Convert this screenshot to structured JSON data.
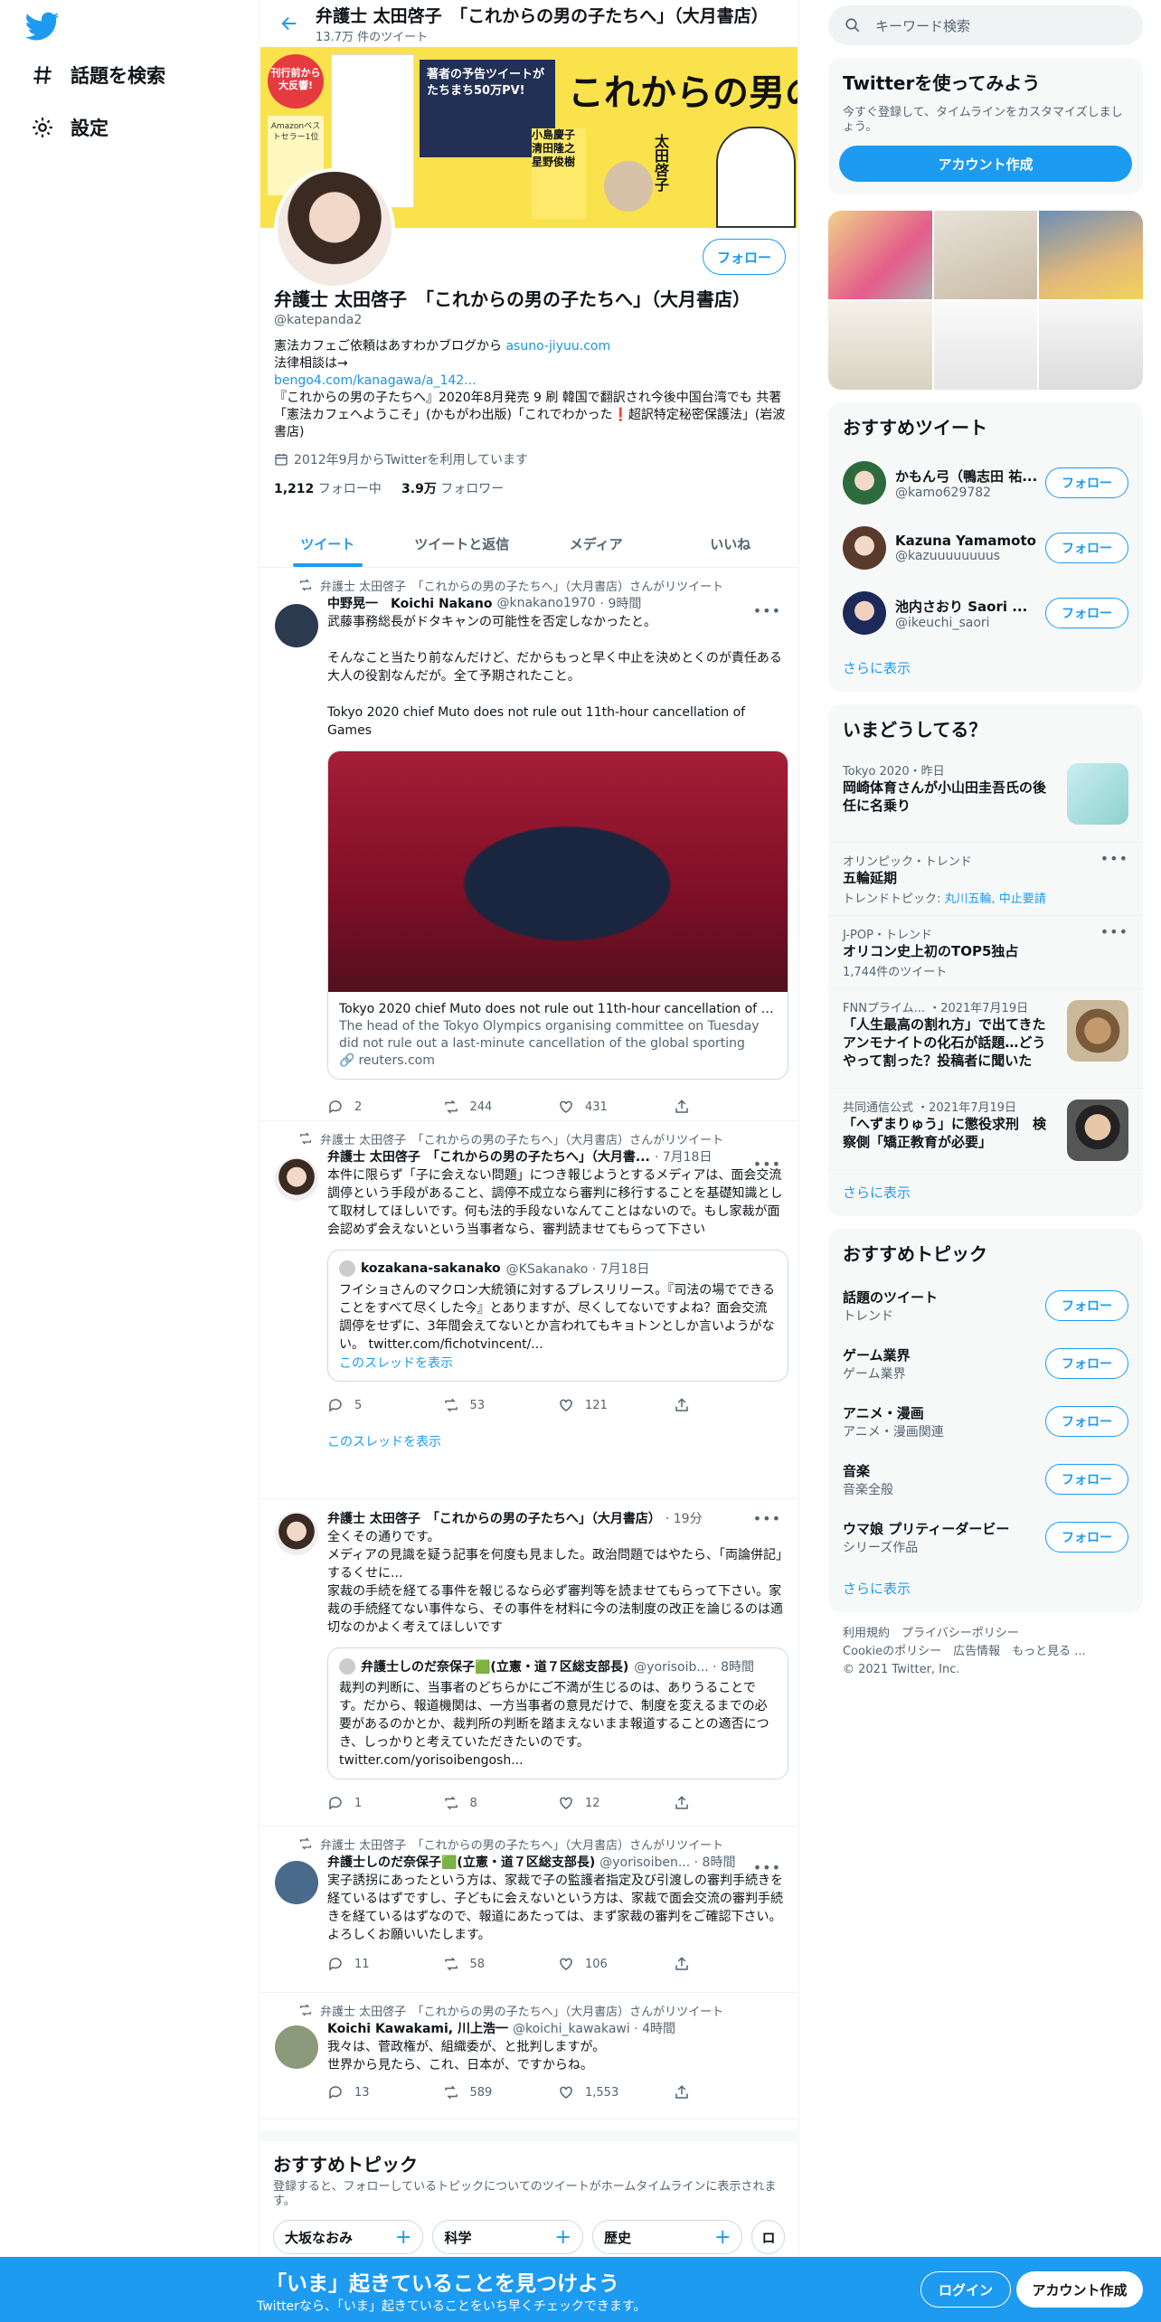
{
  "nav": {
    "items": [
      {
        "label": "話題を検索"
      },
      {
        "label": "設定"
      }
    ]
  },
  "header": {
    "title": "弁護士 太田啓子　「これからの男の子たちへ」（大月書店）",
    "subtitle": "13.7万 件のツイート"
  },
  "banner": {
    "badge": "刊行前から大反響!",
    "note": "Amazonベストセラー1位",
    "headline": "著者の予告ツイートがたちまち50万PV!",
    "title": "これからの男の子たちへ",
    "guests": "小島慶子 清田隆之 星野俊樹",
    "author": "太田啓子"
  },
  "profile": {
    "follow_label": "フォロー",
    "name": "弁護士 太田啓子　「これからの男の子たちへ」（大月書店）",
    "handle": "@katepanda2",
    "bio1": "憲法カフェご依頼はあすわかブログから ",
    "bio1_link": "asuno-jiyuu.com",
    "bio2": "法律相談は→",
    "bio3_link": "bengo4.com/kanagawa/a_142...",
    "bio4": "『これからの男の子たちへ』2020年8月発売  9 刷 韓国で翻訳され今後中国台湾でも 共著「憲法カフェへようこそ」(かもがわ出版)「これでわかった❗超訳特定秘密保護法」(岩波書店)",
    "joined": "2012年9月からTwitterを利用しています",
    "following_count": "1,212",
    "following_label": " フォロー中",
    "followers_count": "3.9万",
    "followers_label": " フォロワー"
  },
  "tabs": [
    {
      "label": "ツイート"
    },
    {
      "label": "ツイートと返信"
    },
    {
      "label": "メディア"
    },
    {
      "label": "いいね"
    }
  ],
  "tweets": [
    {
      "rt": "弁護士 太田啓子　「これからの男の子たちへ」（大月書店）さんがリツイート",
      "name": "中野晃一　Koichi Nakano",
      "handle": "@knakano1970",
      "time": "· 9時間",
      "text": "武藤事務総長がドタキャンの可能性を否定しなかったと。\n\nそんなこと当たり前なんだけど、だからもっと早く中止を決めとくのが責任ある大人の役割なんだが。全て予期されたこと。\n\nTokyo 2020 chief Muto does not rule out 11th-hour cancellation of Games",
      "card_title": "Tokyo 2020 chief Muto does not rule out 11th-hour cancellation of Ga...",
      "card_desc": "The head of the Tokyo Olympics organising committee on Tuesday did not rule out a last-minute cancellation of the global sporting showpiece...",
      "card_source": "reuters.com",
      "replies": "2",
      "retweets": "244",
      "likes": "431"
    },
    {
      "rt": "弁護士 太田啓子　「これからの男の子たちへ」（大月書店）さんがリツイート",
      "name": "弁護士 太田啓子　「これからの男の子たちへ」（大月書...",
      "handle": "· 7月18日",
      "text": "本件に限らず「子に会えない問題」につき報じようとするメディアは、面会交流調停という手段があること、調停不成立なら審判に移行することを基礎知識として取材してほしいです。何も法的手段ないなんてことはないので。もし家裁が面会認めず会えないという当事者なら、審判読ませてもらって下さい",
      "quote_name": "kozakana-sakanako",
      "quote_handle": "@KSakanako · 7月18日",
      "quote_text": "フイショさんのマクロン大統領に対するプレスリリース。『司法の場でできることをすべて尽くした今』とありますが、尽くしてないですよね？面会交流調停をせずに、3年間会えてないとか言われてもキョトンとしか言いようがない。 twitter.com/fichotvincent/...",
      "quote_thread": "このスレッドを表示",
      "replies": "5",
      "retweets": "53",
      "likes": "121",
      "show_thread": "このスレッドを表示"
    },
    {
      "name": "弁護士 太田啓子　「これからの男の子たちへ」（大月書店）",
      "handle": "· 19分",
      "text": "全くその通りです。\nメディアの見識を疑う記事を何度も見ました。政治問題ではやたら、「両論併記」するくせに...\n家裁の手続を経てる事件を報じるなら必ず審判等を読ませてもらって下さい。家裁の手続経てない事件なら、その事件を材料に今の法制度の改正を論じるのは適切なのかよく考えてほしいです",
      "quote_name": "弁護士しのだ奈保子🟩(立憲・道７区総支部長)",
      "quote_handle": "@yorisoib... · 8時間",
      "quote_text": "裁判の判断に、当事者のどちらかにご不満が生じるのは、ありうることです。だから、報道機関は、一方当事者の意見だけで、制度を変えるまでの必要があるのかとか、裁判所の判断を踏まえないまま報道することの適否につき、しっかりと考えていただきたいのです。\ntwitter.com/yorisoibengosh...",
      "replies": "1",
      "retweets": "8",
      "likes": "12"
    },
    {
      "rt": "弁護士 太田啓子　「これからの男の子たちへ」（大月書店）さんがリツイート",
      "name": "弁護士しのだ奈保子🟩(立憲・道７区総支部長)",
      "handle": "@yorisoiben... · 8時間",
      "text": "実子誘拐にあったという方は、家裁で子の監護者指定及び引渡しの審判手続きを経ているはずですし、子どもに会えないという方は、家裁で面会交流の審判手続きを経ているはずなので、報道にあたっては、まず家裁の審判をご確認下さい。よろしくお願いいたします。",
      "replies": "11",
      "retweets": "58",
      "likes": "106"
    },
    {
      "rt": "弁護士 太田啓子　「これからの男の子たちへ」（大月書店）さんがリツイート",
      "name": "Koichi Kawakami, 川上浩一",
      "handle": "@koichi_kawakawi · 4時間",
      "text": "我々は、菅政権が、組織委が、と批判しますが。\n世界から見たら、これ、日本が、ですからね。",
      "replies": "13",
      "retweets": "589",
      "likes": "1,553"
    }
  ],
  "recommended": {
    "title": "おすすめトピック",
    "desc": "登録すると、フォローしているトピックについてのツイートがホームタイムラインに表示されます。",
    "chips": [
      {
        "label": "大坂なおみ"
      },
      {
        "label": "科学"
      },
      {
        "label": "歴史"
      },
      {
        "label": "ロ"
      }
    ]
  },
  "sidebar": {
    "search_placeholder": "キーワード検索",
    "signup_title": "Twitterを使ってみよう",
    "signup_desc": "今すぐ登録して、タイムラインをカスタマイズしましょう。",
    "signup_button": "アカウント作成",
    "who_title": "おすすめツイート",
    "who": [
      {
        "name": "かもん弓（鴨志田 祐...",
        "handle": "@kamo629782",
        "button": "フォロー"
      },
      {
        "name": "Kazuna Yamamoto",
        "handle": "@kazuuuuuuuus",
        "button": "フォロー"
      },
      {
        "name": "池内さおり Saori ...",
        "handle": "@ikeuchi_saori",
        "button": "フォロー"
      }
    ],
    "show_more": "さらに表示",
    "trends_title": "いまどうしてる？",
    "trends": [
      {
        "context": "Tokyo 2020・昨日",
        "title": "岡崎体育さんが小山田圭吾氏の後任に名乗り"
      },
      {
        "context": "オリンピック・トレンド",
        "title": "五輪延期",
        "extra_prefix": "トレンドトピック: ",
        "extra": "丸川五輪, 中止要請"
      },
      {
        "context": "J-POP・トレンド",
        "title": "オリコン史上初のTOP5独占",
        "extra": "1,744件のツイート"
      },
      {
        "context": "FNNプライム... ・2021年7月19日",
        "title": "「人生最高の割れ方」で出てきたアンモナイトの化石が話題…どうやって割った？投稿者に聞いた"
      },
      {
        "context": "共同通信公式 ・2021年7月19日",
        "title": "「へずまりゅう」に懲役求刑　検察側「矯正教育が必要」"
      }
    ],
    "topics_title": "おすすめトピック",
    "topics": [
      {
        "name": "話題のツイート",
        "sub": "トレンド",
        "button": "フォロー"
      },
      {
        "name": "ゲーム業界",
        "sub": "ゲーム業界",
        "button": "フォロー"
      },
      {
        "name": "アニメ・漫画",
        "sub": "アニメ・漫画関連",
        "button": "フォロー"
      },
      {
        "name": "音楽",
        "sub": "音楽全般",
        "button": "フォロー"
      },
      {
        "name": "ウマ娘 プリティーダービー",
        "sub": "シリーズ作品",
        "button": "フォロー"
      }
    ],
    "footer1": "利用規約　プライバシーポリシー",
    "footer2": "Cookieのポリシー　広告情報　もっと見る ...",
    "footer3": "© 2021 Twitter, Inc."
  },
  "bottom": {
    "title": "「いま」起きていることを見つけよう",
    "sub": "Twitterなら、「いま」起きていることをいち早くチェックできます。",
    "login": "ログイン",
    "signup": "アカウント作成"
  },
  "colors": {
    "accent": "#1d9bf0",
    "bar": "#1d9bf0"
  }
}
